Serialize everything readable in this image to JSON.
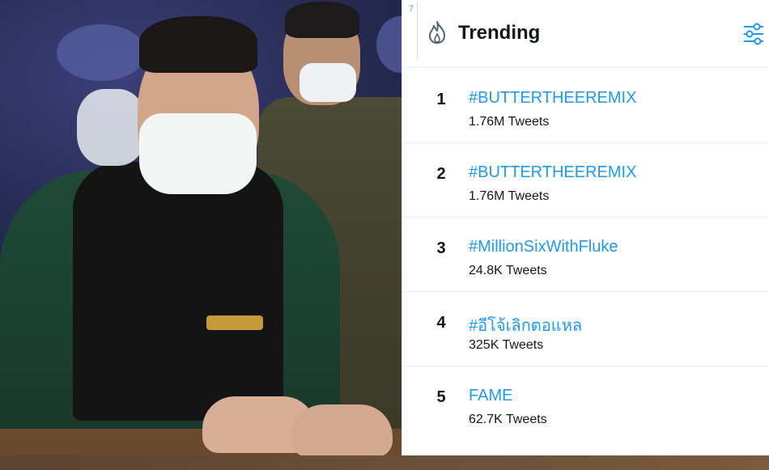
{
  "panel": {
    "gutter_number": "7",
    "title": "Trending",
    "icons": {
      "header": "flame-icon",
      "settings": "filter-sliders-icon"
    },
    "accent_color": "#1d9bf0"
  },
  "trends": [
    {
      "rank": "1",
      "tag": "#BUTTERTHEEREMIX",
      "count": "1.76M Tweets"
    },
    {
      "rank": "2",
      "tag": "#BUTTERTHEEREMIX",
      "count": "1.76M Tweets"
    },
    {
      "rank": "3",
      "tag": "#MillionSixWithFluke",
      "count": "24.8K Tweets"
    },
    {
      "rank": "4",
      "tag": "#อีโจ้เลิกตอแหล",
      "count": "325K Tweets"
    },
    {
      "rank": "5",
      "tag": "FAME",
      "count": "62.7K Tweets"
    }
  ]
}
